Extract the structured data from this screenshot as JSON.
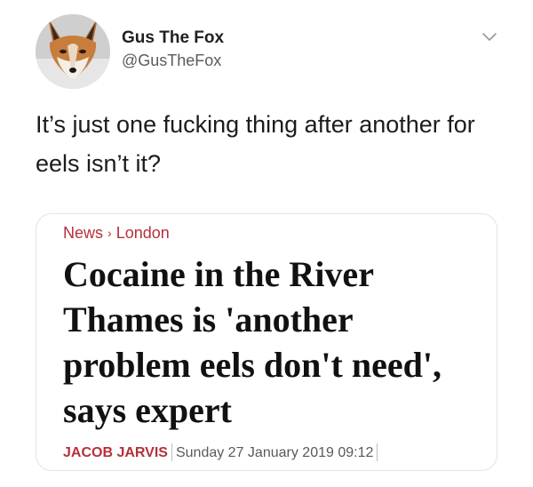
{
  "tweet": {
    "display_name": "Gus The Fox",
    "handle": "@GusTheFox",
    "text": "It’s just one fucking thing after another for eels isn’t it?",
    "menu_icon": "chevron-down-icon",
    "avatar": "fox-photo"
  },
  "article_card": {
    "breadcrumb": [
      "News",
      "London"
    ],
    "breadcrumb_separator_icon": "chevron-right-icon",
    "headline": "Cocaine in the River Thames is 'another problem eels don't need', says expert",
    "author": "JACOB JARVIS",
    "date": "Sunday 27 January 2019 09:12"
  },
  "colors": {
    "accent": "#b5303a",
    "text": "#1c1c1c",
    "muted": "#5b5b5b",
    "card_border": "#e3e3e3"
  }
}
